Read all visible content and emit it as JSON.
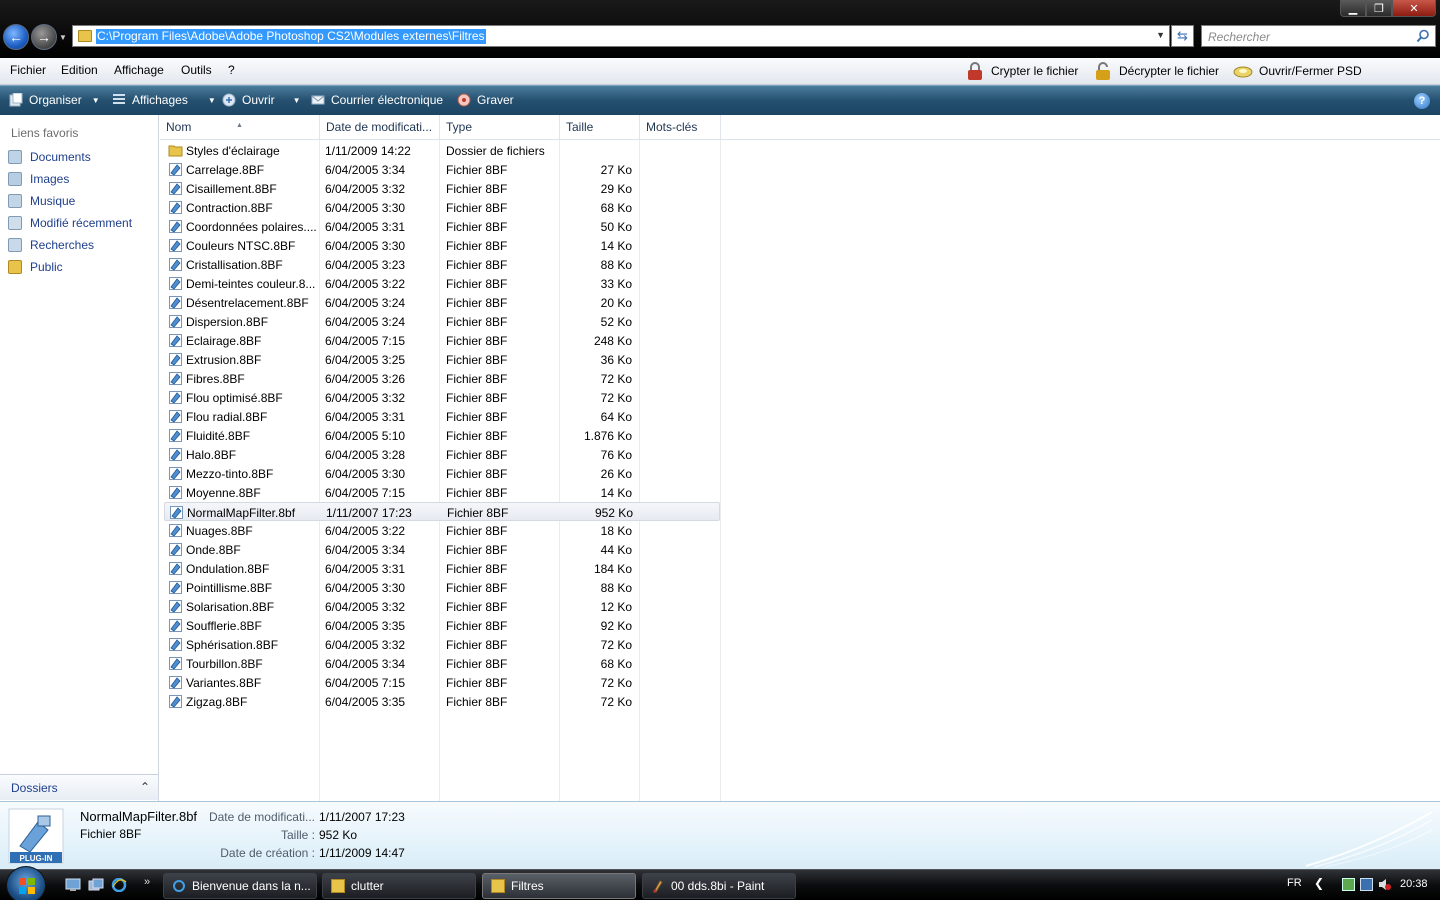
{
  "window": {
    "address": "C:\\Program Files\\Adobe\\Adobe Photoshop CS2\\Modules externes\\Filtres",
    "search_placeholder": "Rechercher",
    "buttons": {
      "minimize": "▁",
      "maximize": "❐",
      "close": "✕"
    }
  },
  "menubar": {
    "items": [
      "Fichier",
      "Edition",
      "Affichage",
      "Outils",
      "?"
    ],
    "extensions": [
      "Crypter le fichier",
      "Décrypter le fichier",
      "Ouvrir/Fermer PSD"
    ]
  },
  "commandbar": {
    "organiser": "Organiser",
    "affichages": "Affichages",
    "ouvrir": "Ouvrir",
    "courrier": "Courrier électronique",
    "graver": "Graver",
    "help": "?"
  },
  "navpane": {
    "title": "Liens favoris",
    "links": [
      "Documents",
      "Images",
      "Musique",
      "Modifié récemment",
      "Recherches",
      "Public"
    ],
    "folders_label": "Dossiers"
  },
  "columns": [
    "Nom",
    "Date de modificati...",
    "Type",
    "Taille",
    "Mots-clés"
  ],
  "files": [
    {
      "name": "Styles d'éclairage",
      "date": "1/11/2009 14:22",
      "type": "Dossier de fichiers",
      "size": "",
      "kind": "folder"
    },
    {
      "name": "Carrelage.8BF",
      "date": "6/04/2005 3:34",
      "type": "Fichier 8BF",
      "size": "27 Ko",
      "kind": "file"
    },
    {
      "name": "Cisaillement.8BF",
      "date": "6/04/2005 3:32",
      "type": "Fichier 8BF",
      "size": "29 Ko",
      "kind": "file"
    },
    {
      "name": "Contraction.8BF",
      "date": "6/04/2005 3:30",
      "type": "Fichier 8BF",
      "size": "68 Ko",
      "kind": "file"
    },
    {
      "name": "Coordonnées polaires....",
      "date": "6/04/2005 3:31",
      "type": "Fichier 8BF",
      "size": "50 Ko",
      "kind": "file"
    },
    {
      "name": "Couleurs NTSC.8BF",
      "date": "6/04/2005 3:30",
      "type": "Fichier 8BF",
      "size": "14 Ko",
      "kind": "file"
    },
    {
      "name": "Cristallisation.8BF",
      "date": "6/04/2005 3:23",
      "type": "Fichier 8BF",
      "size": "88 Ko",
      "kind": "file"
    },
    {
      "name": "Demi-teintes couleur.8...",
      "date": "6/04/2005 3:22",
      "type": "Fichier 8BF",
      "size": "33 Ko",
      "kind": "file"
    },
    {
      "name": "Désentrelacement.8BF",
      "date": "6/04/2005 3:24",
      "type": "Fichier 8BF",
      "size": "20 Ko",
      "kind": "file"
    },
    {
      "name": "Dispersion.8BF",
      "date": "6/04/2005 3:24",
      "type": "Fichier 8BF",
      "size": "52 Ko",
      "kind": "file"
    },
    {
      "name": "Eclairage.8BF",
      "date": "6/04/2005 7:15",
      "type": "Fichier 8BF",
      "size": "248 Ko",
      "kind": "file"
    },
    {
      "name": "Extrusion.8BF",
      "date": "6/04/2005 3:25",
      "type": "Fichier 8BF",
      "size": "36 Ko",
      "kind": "file"
    },
    {
      "name": "Fibres.8BF",
      "date": "6/04/2005 3:26",
      "type": "Fichier 8BF",
      "size": "72 Ko",
      "kind": "file"
    },
    {
      "name": "Flou optimisé.8BF",
      "date": "6/04/2005 3:32",
      "type": "Fichier 8BF",
      "size": "72 Ko",
      "kind": "file"
    },
    {
      "name": "Flou radial.8BF",
      "date": "6/04/2005 3:31",
      "type": "Fichier 8BF",
      "size": "64 Ko",
      "kind": "file"
    },
    {
      "name": "Fluidité.8BF",
      "date": "6/04/2005 5:10",
      "type": "Fichier 8BF",
      "size": "1.876 Ko",
      "kind": "file"
    },
    {
      "name": "Halo.8BF",
      "date": "6/04/2005 3:28",
      "type": "Fichier 8BF",
      "size": "76 Ko",
      "kind": "file"
    },
    {
      "name": "Mezzo-tinto.8BF",
      "date": "6/04/2005 3:30",
      "type": "Fichier 8BF",
      "size": "26 Ko",
      "kind": "file"
    },
    {
      "name": "Moyenne.8BF",
      "date": "6/04/2005 7:15",
      "type": "Fichier 8BF",
      "size": "14 Ko",
      "kind": "file"
    },
    {
      "name": "NormalMapFilter.8bf",
      "date": "1/11/2007 17:23",
      "type": "Fichier 8BF",
      "size": "952 Ko",
      "kind": "file",
      "selected": true
    },
    {
      "name": "Nuages.8BF",
      "date": "6/04/2005 3:22",
      "type": "Fichier 8BF",
      "size": "18 Ko",
      "kind": "file"
    },
    {
      "name": "Onde.8BF",
      "date": "6/04/2005 3:34",
      "type": "Fichier 8BF",
      "size": "44 Ko",
      "kind": "file"
    },
    {
      "name": "Ondulation.8BF",
      "date": "6/04/2005 3:31",
      "type": "Fichier 8BF",
      "size": "184 Ko",
      "kind": "file"
    },
    {
      "name": "Pointillisme.8BF",
      "date": "6/04/2005 3:30",
      "type": "Fichier 8BF",
      "size": "88 Ko",
      "kind": "file"
    },
    {
      "name": "Solarisation.8BF",
      "date": "6/04/2005 3:32",
      "type": "Fichier 8BF",
      "size": "12 Ko",
      "kind": "file"
    },
    {
      "name": "Soufflerie.8BF",
      "date": "6/04/2005 3:35",
      "type": "Fichier 8BF",
      "size": "92 Ko",
      "kind": "file"
    },
    {
      "name": "Sphérisation.8BF",
      "date": "6/04/2005 3:32",
      "type": "Fichier 8BF",
      "size": "72 Ko",
      "kind": "file"
    },
    {
      "name": "Tourbillon.8BF",
      "date": "6/04/2005 3:34",
      "type": "Fichier 8BF",
      "size": "68 Ko",
      "kind": "file"
    },
    {
      "name": "Variantes.8BF",
      "date": "6/04/2005 7:15",
      "type": "Fichier 8BF",
      "size": "72 Ko",
      "kind": "file"
    },
    {
      "name": "Zigzag.8BF",
      "date": "6/04/2005 3:35",
      "type": "Fichier 8BF",
      "size": "72 Ko",
      "kind": "file"
    }
  ],
  "details": {
    "icon_label": "PLUG-IN",
    "name": "NormalMapFilter.8bf",
    "type": "Fichier 8BF",
    "date_label": "Date de modificati...",
    "date_value": "1/11/2007 17:23",
    "size_label": "Taille :",
    "size_value": "952 Ko",
    "created_label": "Date de création :",
    "created_value": "1/11/2009 14:47"
  },
  "taskbar": {
    "quicklaunch_more": "»",
    "tasks": [
      {
        "label": "Bienvenue dans la n...",
        "icon": "ie-icon"
      },
      {
        "label": "clutter",
        "icon": "folder-icon"
      },
      {
        "label": "Filtres",
        "icon": "folder-icon",
        "active": true
      },
      {
        "label": "00 dds.8bi - Paint",
        "icon": "paint-icon"
      }
    ],
    "language": "FR",
    "tray_arrow": "❮",
    "clock": "20:38"
  },
  "colors": {
    "cmdbar": "#25506f",
    "link": "#1e3f8c",
    "selection": "#3399ff",
    "folder": "#e8c44a"
  }
}
